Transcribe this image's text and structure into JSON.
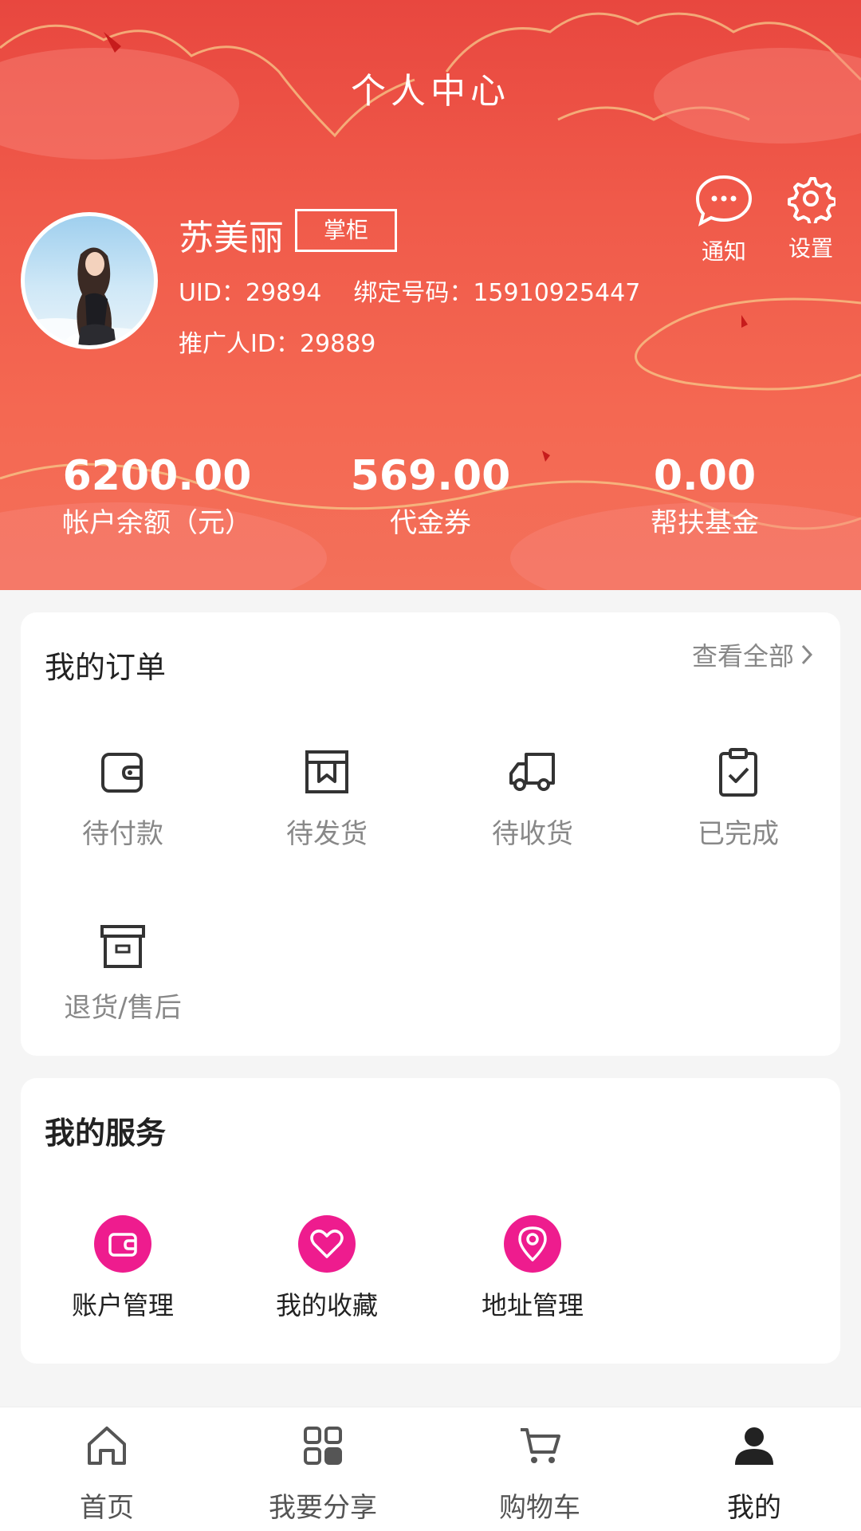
{
  "header": {
    "title": "个人中心",
    "user": {
      "name": "苏美丽",
      "role_badge": "掌柜",
      "uid_label": "UID：",
      "uid": "29894",
      "bound_phone_label": "绑定号码：",
      "bound_phone": "15910925447",
      "referrer_label": "推广人ID：",
      "referrer_id": "29889"
    },
    "actions": [
      {
        "label": "通知",
        "icon": "chat-bubble-icon"
      },
      {
        "label": "设置",
        "icon": "gear-icon"
      }
    ],
    "stats": [
      {
        "value": "6200.00",
        "label": "帐户余额（元）"
      },
      {
        "value": "569.00",
        "label": "代金券"
      },
      {
        "value": "0.00",
        "label": "帮扶基金"
      }
    ]
  },
  "orders": {
    "title": "我的订单",
    "view_all": "查看全部",
    "items": [
      {
        "label": "待付款",
        "icon": "wallet-icon"
      },
      {
        "label": "待发货",
        "icon": "package-icon"
      },
      {
        "label": "待收货",
        "icon": "truck-icon"
      },
      {
        "label": "已完成",
        "icon": "clipboard-check-icon"
      },
      {
        "label": "退货/售后",
        "icon": "archive-box-icon"
      }
    ]
  },
  "services": {
    "title": "我的服务",
    "accent_color": "#ee1c8e",
    "items": [
      {
        "label": "账户管理",
        "icon": "wallet-icon"
      },
      {
        "label": "我的收藏",
        "icon": "heart-icon"
      },
      {
        "label": "地址管理",
        "icon": "location-pin-icon"
      }
    ]
  },
  "bottom_nav": {
    "items": [
      {
        "label": "首页",
        "icon": "home-icon"
      },
      {
        "label": "我要分享",
        "icon": "grid-icon"
      },
      {
        "label": "购物车",
        "icon": "cart-icon"
      },
      {
        "label": "我的",
        "icon": "user-icon",
        "active": true
      }
    ]
  },
  "colors": {
    "header_red": "#f05a4a",
    "accent_pink": "#ee1c8e",
    "background": "#f5f5f5"
  }
}
